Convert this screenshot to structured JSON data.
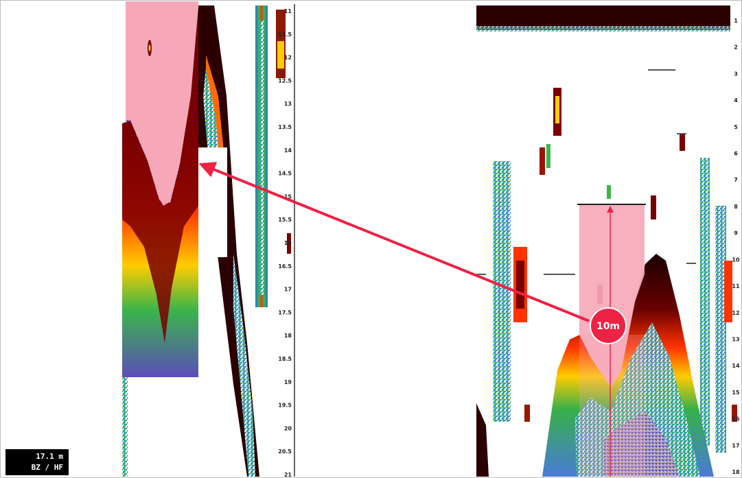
{
  "left_scale": {
    "labels": [
      "11",
      "11.5",
      "12",
      "12.5",
      "13",
      "13.5",
      "14",
      "14.5",
      "15",
      "15.5",
      "16",
      "16.5",
      "17",
      "17.5",
      "18",
      "18.5",
      "19",
      "19.5",
      "20",
      "20.5",
      "21"
    ],
    "start": 11,
    "end": 21
  },
  "right_scale": {
    "labels": [
      "1",
      "2",
      "3",
      "4",
      "5",
      "6",
      "7",
      "8",
      "9",
      "10",
      "11",
      "12",
      "13",
      "14",
      "15",
      "16",
      "17",
      "18"
    ],
    "start": 1,
    "end": 18
  },
  "callout": {
    "label": "10m"
  },
  "readout": {
    "depth": "17.1 m",
    "mode": "BZ / HF"
  },
  "colors": {
    "highlight": "#f7a8b8",
    "arrow": "#ee2244",
    "bottom": "#6b0000",
    "return_red": "#ff3300",
    "return_yellow": "#ffd200",
    "return_green": "#3cb84a",
    "return_blue": "#2a6fd6",
    "return_purple": "#7b5bb8"
  }
}
